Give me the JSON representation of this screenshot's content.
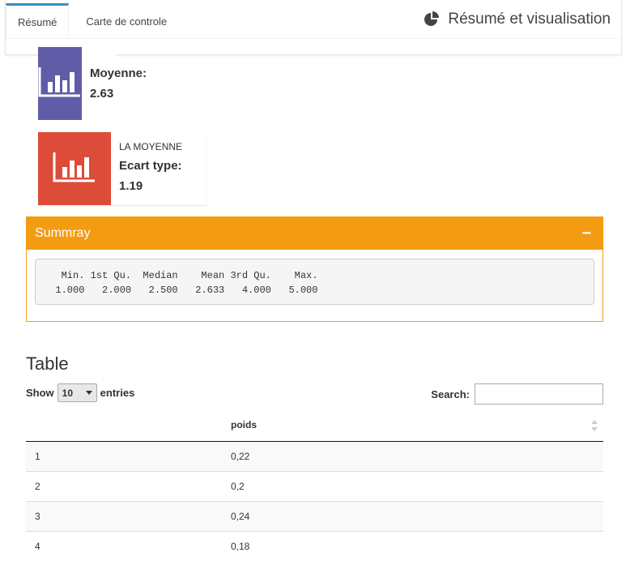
{
  "tabs": [
    {
      "label": "Résumé",
      "active": true
    },
    {
      "label": "Carte de controle",
      "active": false
    }
  ],
  "tabbox": {
    "title": "Résumé et visualisation",
    "icon": "pie-chart-icon"
  },
  "infoboxes": [
    {
      "color": "#605ca8",
      "icon": "bar-chart-icon",
      "subtitle": "",
      "title": "Moyenne:",
      "value": "2.63"
    },
    {
      "color": "#dd4b39",
      "icon": "bar-chart-icon",
      "subtitle": "LA MOYENNE",
      "title": "Ecart type:",
      "value": "1.19"
    }
  ],
  "summary_box": {
    "title": "Summray",
    "collapse_label": "−",
    "color": "#f39c12",
    "output_header": "   Min. 1st Qu.  Median    Mean 3rd Qu.    Max. ",
    "output_values": "  1.000   2.000   2.500   2.633   4.000   5.000 "
  },
  "table": {
    "title": "Table",
    "show_label": "Show",
    "entries_label": "entries",
    "page_length": "10",
    "search_label": "Search:",
    "search_value": "",
    "columns": [
      "",
      "poids"
    ],
    "rows": [
      [
        "1",
        "0,22"
      ],
      [
        "2",
        "0,2"
      ],
      [
        "3",
        "0,24"
      ],
      [
        "4",
        "0,18"
      ]
    ]
  },
  "colors": {
    "accent": "#3c8dbc",
    "purple": "#605ca8",
    "red": "#dd4b39",
    "orange": "#f39c12"
  }
}
